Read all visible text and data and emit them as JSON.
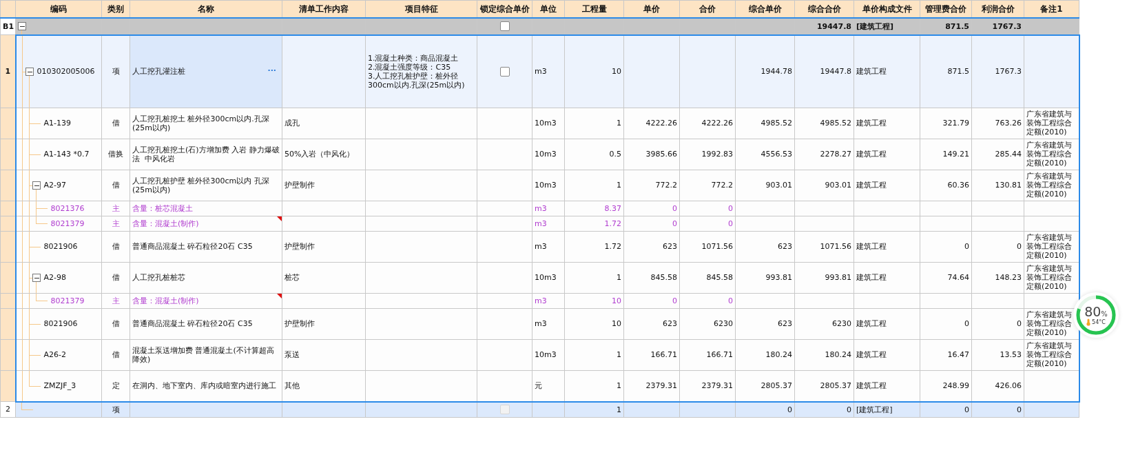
{
  "columns": [
    "编码",
    "类别",
    "名称",
    "清单工作内容",
    "项目特征",
    "锁定综合单价",
    "单位",
    "工程量",
    "单价",
    "合价",
    "综合单价",
    "综合合价",
    "单价构成文件",
    "管理费合价",
    "利润合价",
    "备注1"
  ],
  "summary": {
    "label": "B1",
    "expanded": true,
    "lock": {
      "checked": false,
      "disabled": false
    },
    "comp_total": "19447.8",
    "file": "[建筑工程]",
    "mgmt": "871.5",
    "profit": "1767.3",
    "children": [
      {
        "kind": "item",
        "number": "1",
        "selected": true,
        "focused": true,
        "expanded": true,
        "code": "010302005006",
        "type": "项",
        "name": "人工挖孔灌注桩",
        "name_button": "···",
        "feature": "1.混凝土种类：商品混凝土\n2.混凝土强度等级：C35\n3.人工挖孔桩护壁：桩外径300cm以内.孔深(25m以内)",
        "lock": {
          "checked": false,
          "disabled": false
        },
        "unit": "m3",
        "qty": "10",
        "comp_price": "1944.78",
        "comp_total": "19447.8",
        "file": "建筑工程",
        "mgmt": "871.5",
        "profit": "1767.3",
        "children": [
          {
            "kind": "quota",
            "flagged": false,
            "code": "A1-139",
            "type": "借",
            "name": "人工挖孔桩挖土 桩外径300cm以内.孔深(25m以内)",
            "content": "成孔",
            "unit": "10m3",
            "qty": "1",
            "price": "4222.26",
            "total": "4222.26",
            "comp_price": "4985.52",
            "comp_total": "4985.52",
            "file": "建筑工程",
            "mgmt": "321.79",
            "profit": "763.26",
            "note": "广东省建筑与装饰工程综合定额(2010)"
          },
          {
            "kind": "quota",
            "flagged": false,
            "code": "A1-143 *0.7",
            "type": "借换",
            "name": "人工挖孔桩挖土(石)方增加费 入岩 静力爆破法  中风化岩",
            "content": "50%入岩（中风化）",
            "unit": "10m3",
            "qty": "0.5",
            "price": "3985.66",
            "total": "1992.83",
            "comp_price": "4556.53",
            "comp_total": "2278.27",
            "file": "建筑工程",
            "mgmt": "149.21",
            "profit": "285.44",
            "note": "广东省建筑与装饰工程综合定额(2010)"
          },
          {
            "kind": "quota",
            "flagged": false,
            "expanded": true,
            "code": "A2-97",
            "type": "借",
            "name": "人工挖孔桩护壁 桩外径300cm以内 孔深(25m以内)",
            "content": "护壁制作",
            "unit": "10m3",
            "qty": "1",
            "price": "772.2",
            "total": "772.2",
            "comp_price": "903.01",
            "comp_total": "903.01",
            "file": "建筑工程",
            "mgmt": "60.36",
            "profit": "130.81",
            "note": "广东省建筑与装饰工程综合定额(2010)",
            "children": [
              {
                "kind": "main",
                "flagged": false,
                "code": "8021376",
                "type": "主",
                "name": "含量：桩芯混凝土",
                "unit": "m3",
                "qty": "8.37",
                "price": "0",
                "total": "0"
              },
              {
                "kind": "main",
                "flagged": true,
                "code": "8021379",
                "type": "主",
                "name": "含量：混凝土(制作)",
                "unit": "m3",
                "qty": "1.72",
                "price": "0",
                "total": "0"
              }
            ]
          },
          {
            "kind": "quota",
            "flagged": false,
            "code": "8021906",
            "type": "借",
            "name": "普通商品混凝土 碎石粒径20石 C35",
            "content": "护壁制作",
            "unit": "m3",
            "qty": "1.72",
            "price": "623",
            "total": "1071.56",
            "comp_price": "623",
            "comp_total": "1071.56",
            "file": "建筑工程",
            "mgmt": "0",
            "profit": "0",
            "note": "广东省建筑与装饰工程综合定额(2010)"
          },
          {
            "kind": "quota",
            "flagged": false,
            "expanded": true,
            "code": "A2-98",
            "type": "借",
            "name": "人工挖孔桩桩芯",
            "content": "桩芯",
            "unit": "10m3",
            "qty": "1",
            "price": "845.58",
            "total": "845.58",
            "comp_price": "993.81",
            "comp_total": "993.81",
            "file": "建筑工程",
            "mgmt": "74.64",
            "profit": "148.23",
            "note": "广东省建筑与装饰工程综合定额(2010)",
            "children": [
              {
                "kind": "main",
                "flagged": true,
                "code": "8021379",
                "type": "主",
                "name": "含量：混凝土(制作)",
                "unit": "m3",
                "qty": "10",
                "price": "0",
                "total": "0"
              }
            ]
          },
          {
            "kind": "quota",
            "flagged": false,
            "code": "8021906",
            "type": "借",
            "name": "普通商品混凝土 碎石粒径20石 C35",
            "content": "护壁制作",
            "unit": "m3",
            "qty": "10",
            "price": "623",
            "total": "6230",
            "comp_price": "623",
            "comp_total": "6230",
            "file": "建筑工程",
            "mgmt": "0",
            "profit": "0",
            "note": "广东省建筑与装饰工程综合定额(2010)"
          },
          {
            "kind": "quota",
            "flagged": false,
            "code": "A26-2",
            "type": "借",
            "name": "混凝土泵送增加费 普通混凝土(不计算超高降效)",
            "content": "泵送",
            "unit": "10m3",
            "qty": "1",
            "price": "166.71",
            "total": "166.71",
            "comp_price": "180.24",
            "comp_total": "180.24",
            "file": "建筑工程",
            "mgmt": "16.47",
            "profit": "13.53",
            "note": "广东省建筑与装饰工程综合定额(2010)"
          },
          {
            "kind": "quota",
            "flagged": false,
            "code": "ZMZJF_3",
            "type": "定",
            "name": "在洞内、地下室内、库内或暗室内进行施工",
            "content": "其他",
            "unit": "元",
            "qty": "1",
            "price": "2379.31",
            "total": "2379.31",
            "comp_price": "2805.37",
            "comp_total": "2805.37",
            "file": "建筑工程",
            "mgmt": "248.99",
            "profit": "426.06"
          }
        ]
      },
      {
        "kind": "item",
        "number": "2",
        "selected": false,
        "focused": false,
        "type": "项",
        "lock": {
          "checked": false,
          "disabled": true
        },
        "qty": "1",
        "comp_price": "0",
        "comp_total": "0",
        "file": "[建筑工程]",
        "mgmt": "0",
        "profit": "0"
      }
    ]
  },
  "widget": {
    "value": "80",
    "unit": "%",
    "temperature": "54°C",
    "level": 0.8
  }
}
